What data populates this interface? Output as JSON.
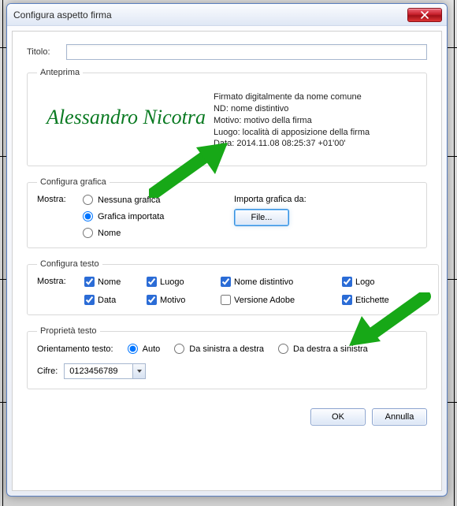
{
  "window": {
    "title": "Configura aspetto firma"
  },
  "title_field": {
    "label": "Titolo:",
    "value": ""
  },
  "preview": {
    "legend": "Anteprima",
    "signature_name": "Alessandro Nicotra",
    "line1": "Firmato digitalmente da nome comune",
    "line2": "ND: nome distintivo",
    "line3": "Motivo: motivo della firma",
    "line4": "Luogo: località di apposizione della firma",
    "line5": "Data: 2014.11.08 08:25:37 +01'00'"
  },
  "graphic": {
    "legend": "Configura grafica",
    "show_label": "Mostra:",
    "opt_none": "Nessuna grafica",
    "opt_imported": "Grafica importata",
    "opt_name": "Nome",
    "selected": "imported",
    "import_label": "Importa grafica da:",
    "file_btn": "File..."
  },
  "text": {
    "legend": "Configura testo",
    "show_label": "Mostra:",
    "items": {
      "nome": {
        "label": "Nome",
        "checked": true
      },
      "luogo": {
        "label": "Luogo",
        "checked": true
      },
      "nome_distintivo": {
        "label": "Nome distintivo",
        "checked": true
      },
      "logo": {
        "label": "Logo",
        "checked": true
      },
      "data": {
        "label": "Data",
        "checked": true
      },
      "motivo": {
        "label": "Motivo",
        "checked": true
      },
      "versione_adobe": {
        "label": "Versione Adobe",
        "checked": false
      },
      "etichette": {
        "label": "Etichette",
        "checked": true
      }
    }
  },
  "text_props": {
    "legend": "Proprietà testo",
    "orient_label": "Orientamento testo:",
    "opt_auto": "Auto",
    "opt_ltr": "Da sinistra a destra",
    "opt_rtl": "Da destra a sinistra",
    "selected": "auto",
    "digits_label": "Cifre:",
    "digits_value": "0123456789"
  },
  "buttons": {
    "ok": "OK",
    "cancel": "Annulla"
  }
}
